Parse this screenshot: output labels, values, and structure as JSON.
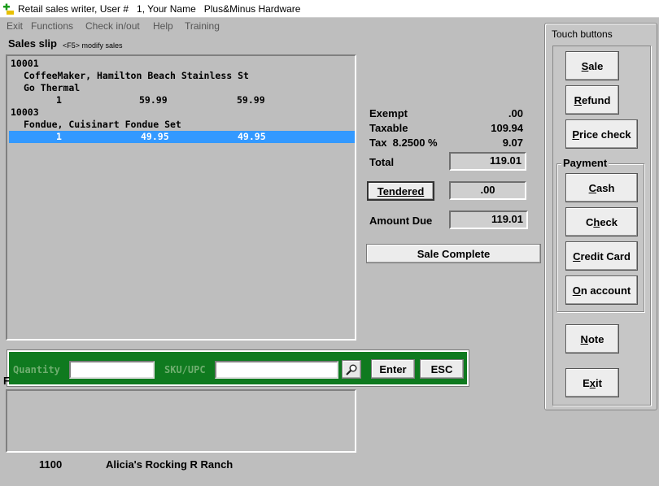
{
  "window": {
    "title": "Retail sales writer, User #   1, Your Name   Plus&Minus Hardware"
  },
  "menu": [
    "Exit",
    "Functions",
    "Check in/out",
    "Help",
    "Training"
  ],
  "slip": {
    "label": "Sales slip",
    "hint": "<F5> modify sales",
    "lines": [
      {
        "sku": "10001"
      },
      {
        "desc": "CoffeeMaker, Hamilton Beach Stainless St"
      },
      {
        "desc": "Go Thermal"
      },
      {
        "qty": "1",
        "price": "59.99",
        "ext": "59.99"
      },
      {
        "sku": "10003"
      },
      {
        "desc": "Fondue, Cuisinart Fondue Set"
      },
      {
        "qty": "1",
        "price": "49.95",
        "ext": "49.95",
        "selected": true
      }
    ]
  },
  "totals": {
    "exempt_label": "Exempt",
    "exempt_value": ".00",
    "taxable_label": "Taxable",
    "taxable_value": "109.94",
    "tax_label": "Tax  8.2500 %",
    "tax_value": "9.07",
    "total_label": "Total",
    "total_value": "119.01",
    "tendered_button": "Tendered",
    "tendered_value": ".00",
    "amount_due_label": "Amount Due",
    "amount_due_value": "119.01",
    "sale_complete_button": "Sale Complete"
  },
  "entry": {
    "quantity_label": "Quantity",
    "quantity_value": "",
    "sku_label": "SKU/UPC",
    "sku_value": "",
    "lookup_icon": "magnifier-icon",
    "enter_button": "Enter",
    "esc_button": "ESC"
  },
  "lower": {
    "fragment": "F",
    "customer_number": "1100",
    "customer_name": "Alicia's Rocking R Ranch"
  },
  "touch": {
    "title": "Touch buttons",
    "sale": {
      "pre": "",
      "ul": "S",
      "post": "ale"
    },
    "refund": {
      "pre": "",
      "ul": "R",
      "post": "efund"
    },
    "price_check": {
      "pre": "",
      "ul": "P",
      "post": "rice check"
    },
    "payment_label": "Payment",
    "cash": {
      "pre": "",
      "ul": "C",
      "post": "ash"
    },
    "check": {
      "pre": "C",
      "ul": "h",
      "post": "eck"
    },
    "credit_card": {
      "pre": "",
      "ul": "C",
      "post": "redit Card"
    },
    "on_account": {
      "pre": "",
      "ul": "O",
      "post": "n account"
    },
    "note": {
      "pre": "",
      "ul": "N",
      "post": "ote"
    },
    "exit": {
      "pre": "E",
      "ul": "x",
      "post": "it"
    }
  },
  "colors": {
    "selection": "#3399ff",
    "entry_strip": "#0f7a1f",
    "background": "#bebebe"
  }
}
